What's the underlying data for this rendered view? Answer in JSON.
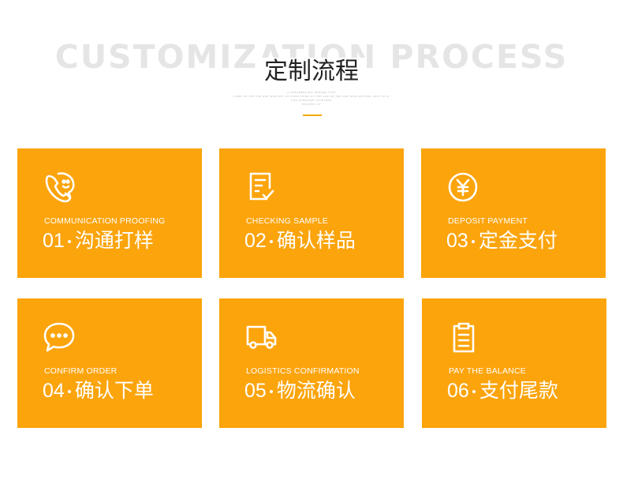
{
  "header": {
    "background_title": "CUSTOMIZATION PROCESS",
    "title": "定制流程",
    "fine_print_line1": "A DREAMERS BIG DREAMS THAT",
    "fine_print_line2": "COME TO THE THE ONE WHO SET OF EVERYTHING OF THE CAN OR THE ONE WHO GETTING INTO TO IS",
    "fine_print_line3": "FOR EVERYONE TOGETHER",
    "fine_print_line4": "PROCESS OF"
  },
  "colors": {
    "card_background": "#fca40c",
    "accent": "#f4a90c",
    "title_text": "#222222",
    "background_title_text": "#e5e5e5"
  },
  "steps": [
    {
      "en": "COMMUNICATION PROOFING",
      "num": "01",
      "cn": "沟通打样",
      "icon": "phone-chat-icon"
    },
    {
      "en": "CHECKING SAMPLE",
      "num": "02",
      "cn": "确认样品",
      "icon": "document-check-icon"
    },
    {
      "en": "DEPOSIT PAYMENT",
      "num": "03",
      "cn": "定金支付",
      "icon": "yen-coin-icon"
    },
    {
      "en": "CONFIRM ORDER",
      "num": "04",
      "cn": "确认下单",
      "icon": "speech-bubble-icon"
    },
    {
      "en": "LOGISTICS CONFIRMATION",
      "num": "05",
      "cn": "物流确认",
      "icon": "delivery-truck-icon"
    },
    {
      "en": "PAY THE BALANCE",
      "num": "06",
      "cn": "支付尾款",
      "icon": "clipboard-list-icon"
    }
  ]
}
